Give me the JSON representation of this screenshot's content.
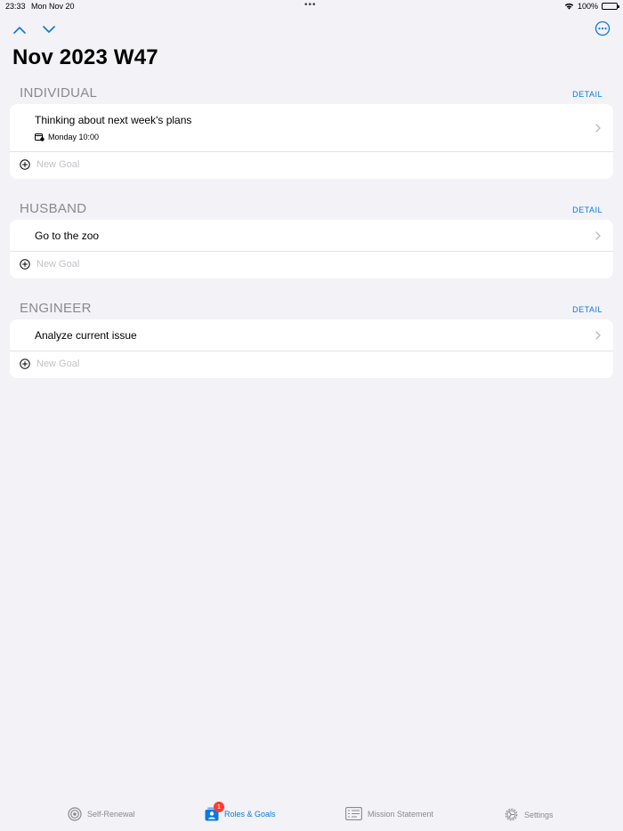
{
  "status": {
    "time": "23:33",
    "date": "Mon Nov 20",
    "battery": "100%"
  },
  "page": {
    "title": "Nov 2023 W47"
  },
  "sections": [
    {
      "title": "INDIVIDUAL",
      "detail": "DETAIL",
      "goals": [
        {
          "label": "Thinking about next week's plans",
          "meta": "Monday 10:00"
        }
      ],
      "new_goal_placeholder": "New Goal"
    },
    {
      "title": "HUSBAND",
      "detail": "DETAIL",
      "goals": [
        {
          "label": "Go to the zoo"
        }
      ],
      "new_goal_placeholder": "New Goal"
    },
    {
      "title": "ENGINEER",
      "detail": "DETAIL",
      "goals": [
        {
          "label": "Analyze current issue"
        }
      ],
      "new_goal_placeholder": "New Goal"
    }
  ],
  "tabs": [
    {
      "label": "Self-Renewal",
      "icon": "target-icon",
      "active": false
    },
    {
      "label": "Roles & Goals",
      "icon": "roles-icon",
      "active": true,
      "badge": "1"
    },
    {
      "label": "Mission Statement",
      "icon": "mission-statement-icon",
      "active": false
    },
    {
      "label": "Settings",
      "icon": "gear-icon",
      "active": false
    }
  ],
  "colors": {
    "accent": "#0a7ae0",
    "background": "#f2f2f7",
    "badge": "#ff3b30",
    "section_title": "#8a8a8e"
  }
}
